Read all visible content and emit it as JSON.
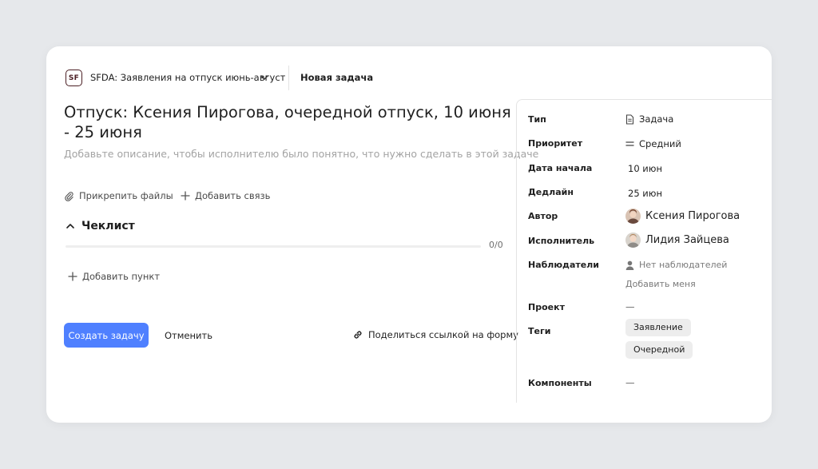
{
  "header": {
    "queue_logo": "SF",
    "queue_name": "SFDA: Заявления на отпуск июнь-август",
    "crumb": "Новая задача"
  },
  "task": {
    "title": "Отпуск: Ксения Пирогова, очередной отпуск, 10 июня - 25 июня",
    "description_placeholder": "Добавьте описание, чтобы исполнителю было понятно, что нужно сделать в этой задаче"
  },
  "actions": {
    "attach": "Прикрепить файлы",
    "add_link": "Добавить связь",
    "share": "Поделиться ссылкой на форму"
  },
  "checklist": {
    "title": "Чеклист",
    "count": "0/0",
    "progress": 0,
    "add_item": "Добавить пункт"
  },
  "buttons": {
    "create": "Создать задачу",
    "cancel": "Отменить"
  },
  "properties": {
    "type": {
      "label": "Тип",
      "value": "Задача"
    },
    "priority": {
      "label": "Приоритет",
      "value": "Средний"
    },
    "start": {
      "label": "Дата начала",
      "value": "10 июн"
    },
    "deadline": {
      "label": "Дедлайн",
      "value": "25 июн"
    },
    "author": {
      "label": "Автор",
      "value": "Ксения Пирогова"
    },
    "assignee": {
      "label": "Исполнитель",
      "value": "Лидия Зайцева"
    },
    "watchers": {
      "label": "Наблюдатели",
      "value": "Нет наблюдателей",
      "add_me": "Добавить меня"
    },
    "project": {
      "label": "Проект",
      "value": "—"
    },
    "tags": {
      "label": "Теги",
      "items": [
        "Заявление",
        "Очередной"
      ]
    },
    "components": {
      "label": "Компоненты",
      "value": "—"
    }
  },
  "colors": {
    "primary": "#4f80ff",
    "logo": "#4b1f24",
    "placeholder": "#a3a3a3"
  }
}
